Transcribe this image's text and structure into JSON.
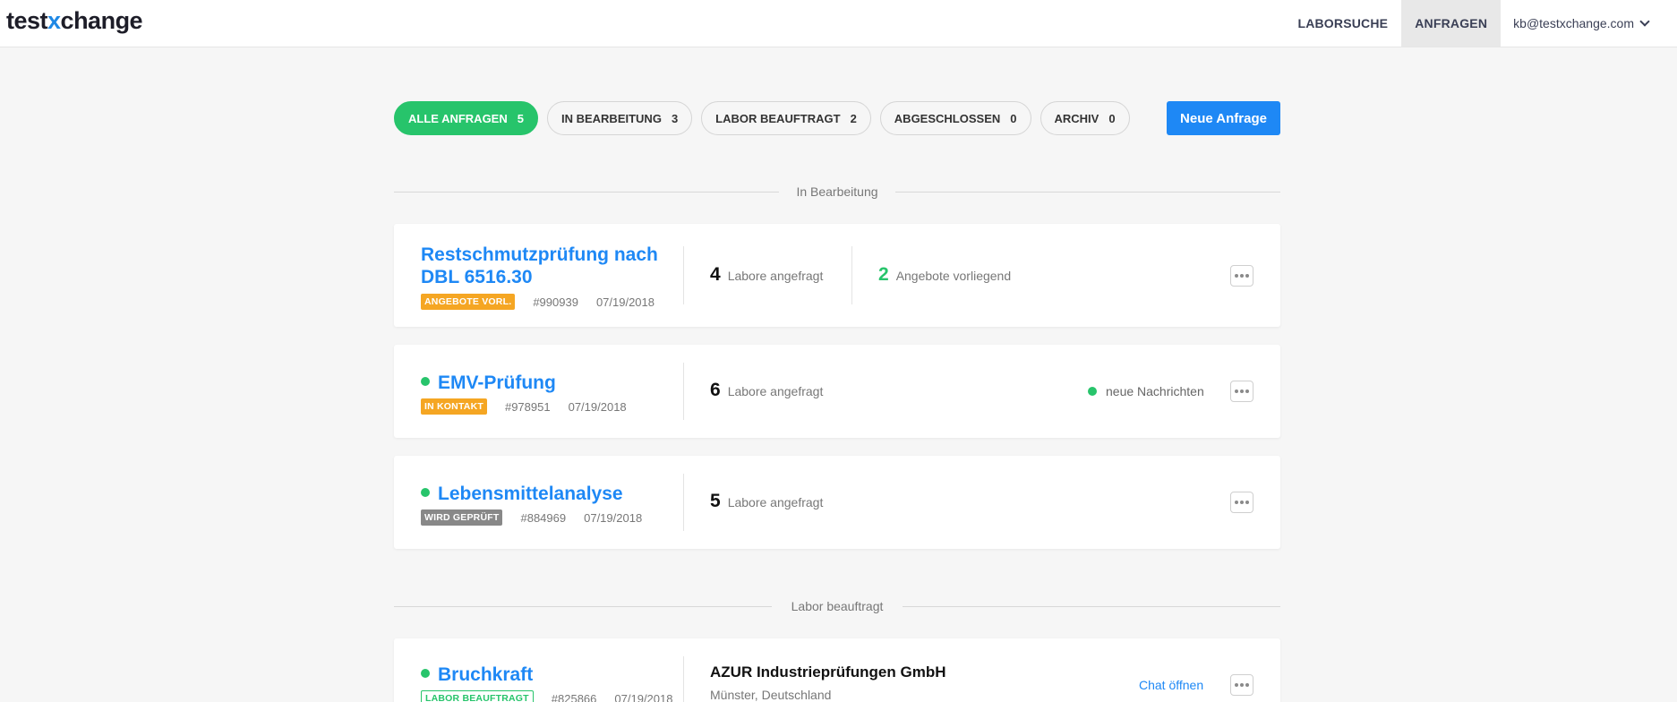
{
  "header": {
    "logo_prefix": "test",
    "logo_x": "x",
    "logo_suffix": "change",
    "nav_labsearch": "LABORSUCHE",
    "nav_requests": "ANFRAGEN",
    "user_email": "kb@testxchange.com"
  },
  "filters": [
    {
      "label": "ALLE ANFRAGEN",
      "count": "5",
      "active": true
    },
    {
      "label": "IN BEARBEITUNG",
      "count": "3",
      "active": false
    },
    {
      "label": "LABOR BEAUFTRAGT",
      "count": "2",
      "active": false
    },
    {
      "label": "ABGESCHLOSSEN",
      "count": "0",
      "active": false
    },
    {
      "label": "ARCHIV",
      "count": "0",
      "active": false
    }
  ],
  "new_request_label": "Neue Anfrage",
  "sections": {
    "in_progress": "In Bearbeitung",
    "lab_assigned": "Labor beauftragt"
  },
  "cards": [
    {
      "title_line1": "Restschmutzprüfung nach",
      "title_line2": "DBL 6516.30",
      "badge": "ANGEBOTE VORL.",
      "id": "#990939",
      "date": "07/19/2018",
      "labs_count": "4",
      "labs_label": "Labore angefragt",
      "offers_count": "2",
      "offers_label": "Angebote vorliegend"
    },
    {
      "title": "EMV-Prüfung",
      "badge": "IN KONTAKT",
      "id": "#978951",
      "date": "07/19/2018",
      "labs_count": "6",
      "labs_label": "Labore angefragt",
      "message": "neue Nachrichten"
    },
    {
      "title": "Lebensmittelanalyse",
      "badge": "WIRD GEPRÜFT",
      "id": "#884969",
      "date": "07/19/2018",
      "labs_count": "5",
      "labs_label": "Labore angefragt"
    },
    {
      "title": "Bruchkraft",
      "badge": "LABOR BEAUFTRAGT",
      "id": "#825866",
      "date": "07/19/2018",
      "lab_name": "AZUR Industrieprüfungen GmbH",
      "lab_location": "Münster, Deutschland",
      "chat_label": "Chat öffnen"
    }
  ],
  "colors": {
    "accent_blue": "#1e88f5",
    "accent_green": "#27c46b",
    "badge_orange": "#f5a623",
    "badge_gray": "#888888"
  },
  "icons": [
    "chevron-down-icon",
    "more-options-icon",
    "unread-dot-icon"
  ]
}
